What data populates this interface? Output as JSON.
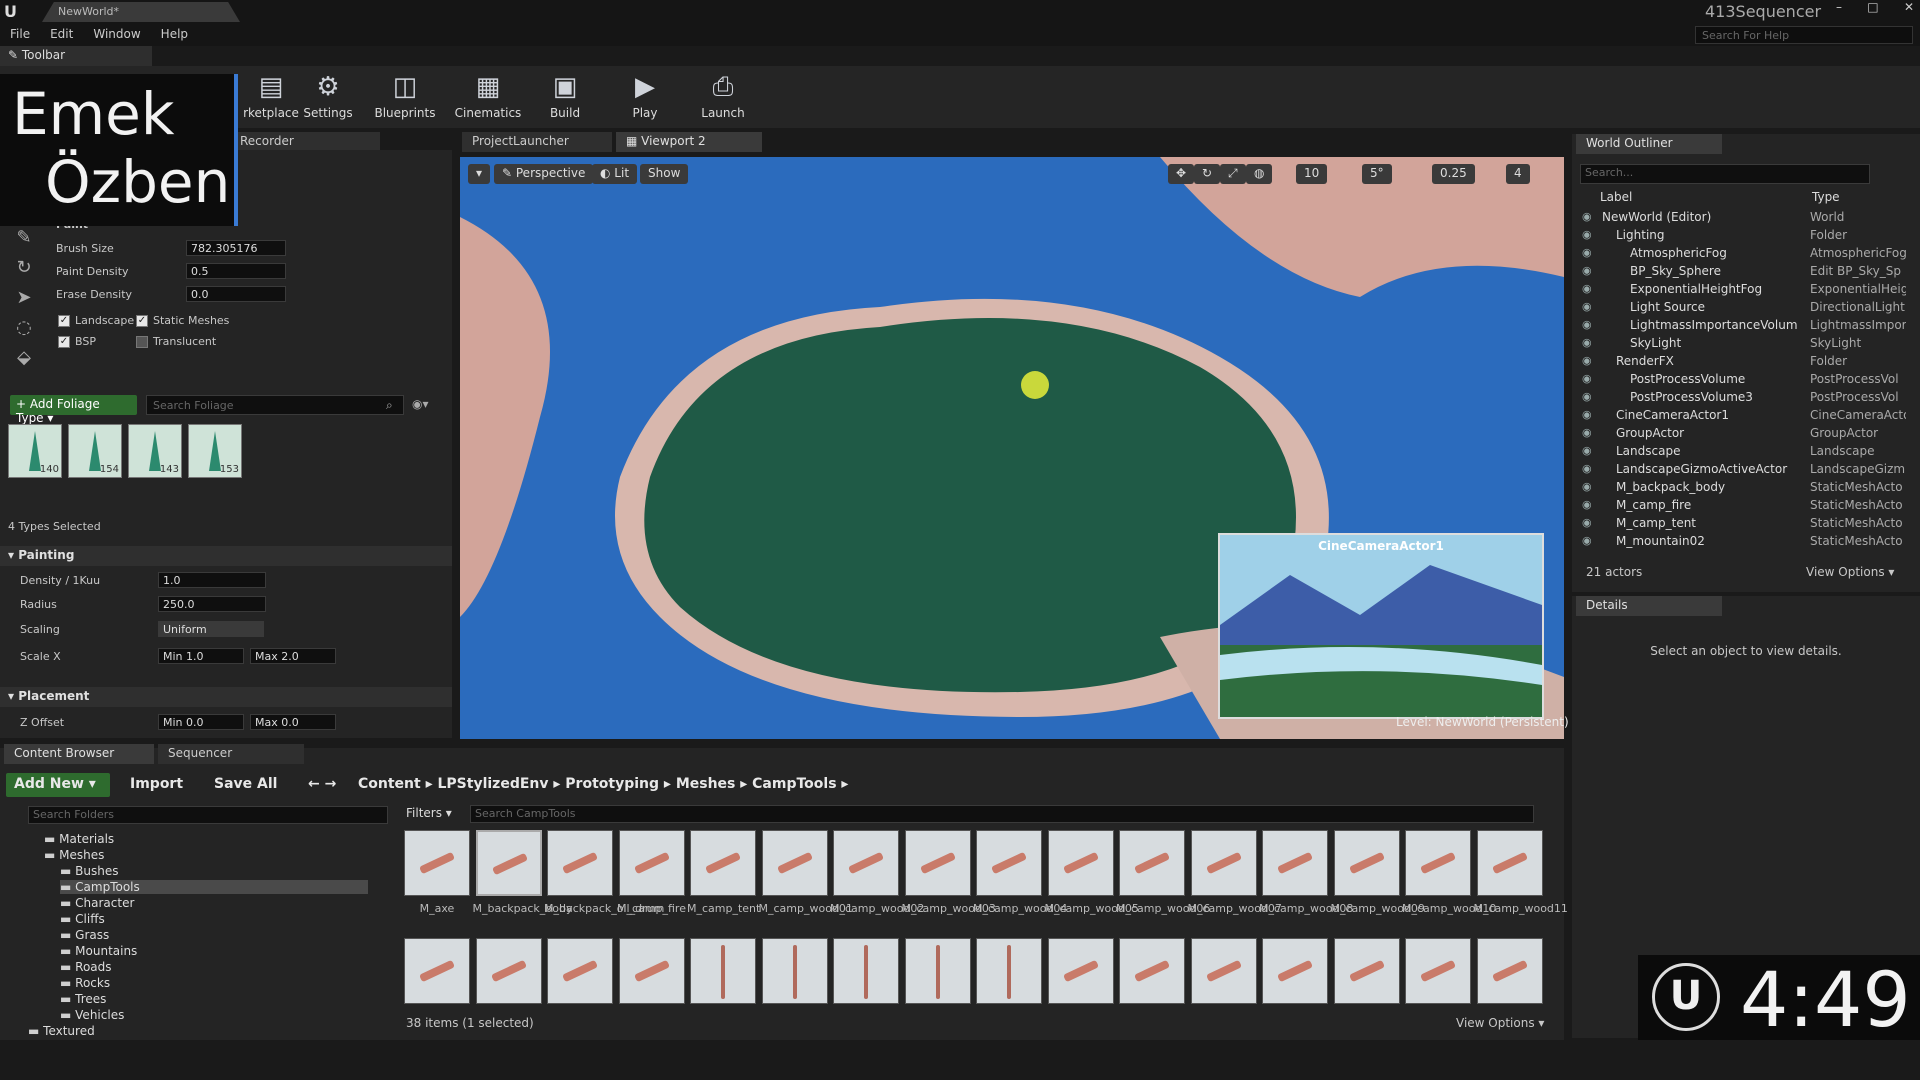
{
  "app": {
    "doc_tab": "NewWorld*",
    "project": "413Sequencer",
    "window_controls": [
      "–",
      "□",
      "✕"
    ]
  },
  "menu": [
    "File",
    "Edit",
    "Window",
    "Help"
  ],
  "search_help": {
    "placeholder": "Search For Help"
  },
  "toolbar_tab": "Toolbar",
  "toolbar": {
    "buttons": [
      {
        "label": "rketplace",
        "icon": "marketplace-icon"
      },
      {
        "label": "Settings",
        "icon": "gear-icon"
      },
      {
        "label": "Blueprints",
        "icon": "blueprint-icon"
      },
      {
        "label": "Cinematics",
        "icon": "clapper-icon"
      },
      {
        "label": "Build",
        "icon": "build-icon"
      },
      {
        "label": "Play",
        "icon": "play-icon"
      },
      {
        "label": "Launch",
        "icon": "launch-icon"
      }
    ]
  },
  "overlay": {
    "line1": "Emek",
    "line2": "Özben"
  },
  "tabs": {
    "recorder": "Recorder",
    "project_launcher": "ProjectLauncher",
    "viewport": "Viewport 2"
  },
  "foliage": {
    "section": "Paint",
    "brush_size": {
      "label": "Brush Size",
      "value": "782.305176"
    },
    "paint_density": {
      "label": "Paint Density",
      "value": "0.5"
    },
    "erase_density": {
      "label": "Erase Density",
      "value": "0.0"
    },
    "filters": [
      {
        "label": "Landscape",
        "checked": true
      },
      {
        "label": "Static Meshes",
        "checked": true
      },
      {
        "label": "BSP",
        "checked": true
      },
      {
        "label": "Translucent",
        "checked": false
      }
    ],
    "add_button": "+ Add Foliage Type ▾",
    "search_placeholder": "Search Foliage",
    "types": [
      "140",
      "154",
      "143",
      "153"
    ],
    "types_selected": "4 Types Selected",
    "painting": {
      "header": "Painting",
      "density": {
        "label": "Density / 1Kuu",
        "value": "1.0"
      },
      "radius": {
        "label": "Radius",
        "value": "250.0"
      },
      "scaling": {
        "label": "Scaling",
        "value": "Uniform"
      },
      "scale_x": {
        "label": "Scale X",
        "min": "Min  1.0",
        "max": "Max  2.0"
      }
    },
    "placement": {
      "header": "Placement",
      "z_offset": {
        "label": "Z Offset",
        "min": "Min  0.0",
        "max": "Max  0.0"
      }
    }
  },
  "viewport": {
    "perspective": "Perspective",
    "lit": "Lit",
    "show": "Show",
    "grid": "10",
    "angle": "5°",
    "scale": "0.25",
    "cam_speed": "4",
    "cine_label": "CineCameraActor1",
    "level": "Level:  NewWorld (Persistent)"
  },
  "outliner": {
    "tab": "World Outliner",
    "search_placeholder": "Search...",
    "col_label": "Label",
    "col_type": "Type",
    "rows": [
      {
        "label": "NewWorld (Editor)",
        "type": "World",
        "indent": 0
      },
      {
        "label": "Lighting",
        "type": "Folder",
        "indent": 1
      },
      {
        "label": "AtmosphericFog",
        "type": "AtmosphericFog",
        "indent": 2
      },
      {
        "label": "BP_Sky_Sphere",
        "type": "Edit BP_Sky_Sp",
        "indent": 2
      },
      {
        "label": "ExponentialHeightFog",
        "type": "ExponentialHeig",
        "indent": 2
      },
      {
        "label": "Light Source",
        "type": "DirectionalLight",
        "indent": 2
      },
      {
        "label": "LightmassImportanceVolum",
        "type": "LightmassImpor",
        "indent": 2
      },
      {
        "label": "SkyLight",
        "type": "SkyLight",
        "indent": 2
      },
      {
        "label": "RenderFX",
        "type": "Folder",
        "indent": 1
      },
      {
        "label": "PostProcessVolume",
        "type": "PostProcessVol",
        "indent": 2
      },
      {
        "label": "PostProcessVolume3",
        "type": "PostProcessVol",
        "indent": 2
      },
      {
        "label": "CineCameraActor1",
        "type": "CineCameraActo",
        "indent": 1
      },
      {
        "label": "GroupActor",
        "type": "GroupActor",
        "indent": 1
      },
      {
        "label": "Landscape",
        "type": "Landscape",
        "indent": 1
      },
      {
        "label": "LandscapeGizmoActiveActor",
        "type": "LandscapeGizm",
        "indent": 1
      },
      {
        "label": "M_backpack_body",
        "type": "StaticMeshActo",
        "indent": 1
      },
      {
        "label": "M_camp_fire",
        "type": "StaticMeshActo",
        "indent": 1
      },
      {
        "label": "M_camp_tent",
        "type": "StaticMeshActo",
        "indent": 1
      },
      {
        "label": "M_mountain02",
        "type": "StaticMeshActo",
        "indent": 1
      }
    ],
    "actor_count": "21 actors",
    "view_options": "View Options ▾"
  },
  "details": {
    "tab": "Details",
    "empty": "Select an object to view details."
  },
  "content_browser": {
    "tab": "Content Browser",
    "sequencer_tab": "Sequencer",
    "add_new": "Add New ▾",
    "import": "Import",
    "save_all": "Save All",
    "path": [
      "Content",
      "LPStylizedEnv",
      "Prototyping",
      "Meshes",
      "CampTools"
    ],
    "search_folders": "Search Folders",
    "filters": "Filters ▾",
    "search_assets": "Search CampTools",
    "folders": [
      {
        "label": "Materials",
        "indent": 1
      },
      {
        "label": "Meshes",
        "indent": 1
      },
      {
        "label": "Bushes",
        "indent": 2
      },
      {
        "label": "CampTools",
        "indent": 2,
        "selected": true
      },
      {
        "label": "Character",
        "indent": 2
      },
      {
        "label": "Cliffs",
        "indent": 2
      },
      {
        "label": "Grass",
        "indent": 2
      },
      {
        "label": "Mountains",
        "indent": 2
      },
      {
        "label": "Roads",
        "indent": 2
      },
      {
        "label": "Rocks",
        "indent": 2
      },
      {
        "label": "Trees",
        "indent": 2
      },
      {
        "label": "Vehicles",
        "indent": 2
      },
      {
        "label": "Textured",
        "indent": 0
      }
    ],
    "assets_row1": [
      "M_axe",
      "M_backpack_body",
      "M_backpack_oil_drum",
      "M_camp_fire",
      "M_camp_tent",
      "M_camp_wood01",
      "M_camp_wood02",
      "M_camp_wood03",
      "M_camp_wood04",
      "M_camp_wood05",
      "M_camp_wood06",
      "M_camp_wood07",
      "M_camp_wood08",
      "M_camp_wood09",
      "M_camp_wood10",
      "M_camp_wood11"
    ],
    "items_status": "38 items (1 selected)",
    "view_options": "View Options ▾"
  },
  "timer": {
    "value": "4:49"
  },
  "colors": {
    "accent": "#3a7bd5",
    "add_green": "#2e6b2e",
    "water": "#1d5fa8",
    "island": "#1f5a46"
  }
}
